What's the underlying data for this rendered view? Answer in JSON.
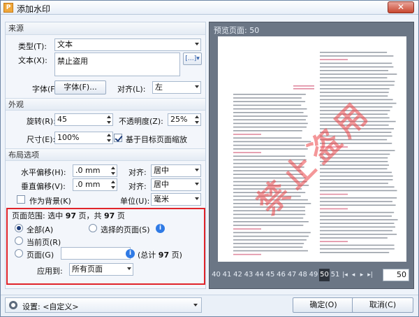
{
  "window": {
    "title": "添加水印",
    "app_icon_letter": "P"
  },
  "source": {
    "header": "来源",
    "type_label": "类型(T):",
    "type_value": "文本",
    "text_label": "文本(X):",
    "text_value": "禁止盗用",
    "font_label": "字体(F):",
    "font_button": "字体(F)...",
    "align_label": "对齐(L):",
    "align_value": "左"
  },
  "appearance": {
    "header": "外观",
    "rotation_label": "旋转(R):",
    "rotation_value": "45",
    "opacity_label": "不透明度(Z):",
    "opacity_value": "25%",
    "size_label": "尺寸(E):",
    "size_value": "100%",
    "scale_checkbox_label": "基于目标页面缩放"
  },
  "layout": {
    "header": "布局选项",
    "hoffset_label": "水平偏移(H):",
    "hoffset_value": ".0 mm",
    "halign_label": "对齐:",
    "halign_value": "居中",
    "voffset_label": "垂直偏移(V):",
    "voffset_value": ".0 mm",
    "valign_label": "对齐:",
    "valign_value": "居中",
    "background_label": "作为背景(K)",
    "units_label": "单位(U):",
    "units_value": "毫米"
  },
  "page_range": {
    "summary_prefix": "页面范围: 选中 ",
    "selected_count": "97",
    "summary_mid": " 页，共 ",
    "total_count": "97",
    "summary_suffix": " 页",
    "all_label": "全部(A)",
    "selected_pages_label": "选择的页面(S)",
    "current_label": "当前页(R)",
    "pages_label": "页面(G)",
    "pages_input_value": "",
    "total_prefix": "(总计 ",
    "total_value": "97",
    "total_suffix": " 页)",
    "apply_label": "应用到:",
    "apply_value": "所有页面"
  },
  "preview": {
    "title": "预览页面: 50",
    "pages": [
      "40",
      "41",
      "42",
      "43",
      "44",
      "45",
      "46",
      "47",
      "48",
      "49",
      "50",
      "51"
    ],
    "current_page": "50",
    "page_input": "50",
    "watermark_text": "禁止盗用"
  },
  "footer": {
    "settings_label": "设置: <自定义>",
    "ok_label": "确定(O)",
    "cancel_label": "取消(C)"
  },
  "colors": {
    "highlight_border": "#e0242a",
    "watermark": "#eb4146",
    "preview_background": "#6b7685",
    "radio_fill": "#1b3b7a"
  }
}
